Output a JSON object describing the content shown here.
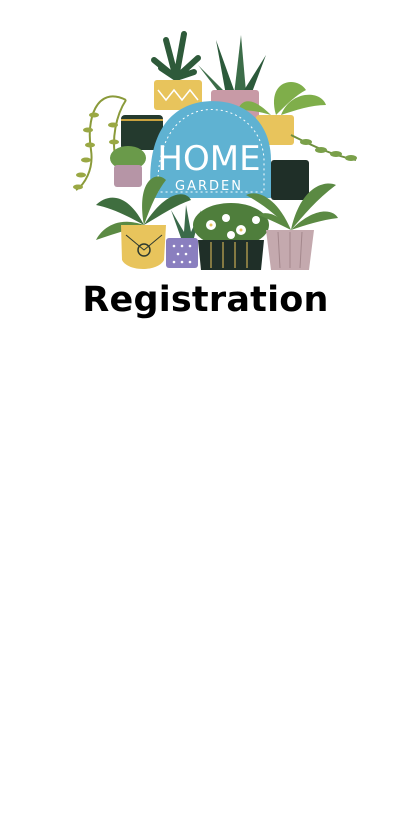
{
  "logo": {
    "line1": "HOME",
    "line2": "GARDEN",
    "badge_color": "#5fb2d2",
    "icon": "potted-plants-illustration"
  },
  "page": {
    "title": "Registration",
    "background": "#ffffff"
  }
}
